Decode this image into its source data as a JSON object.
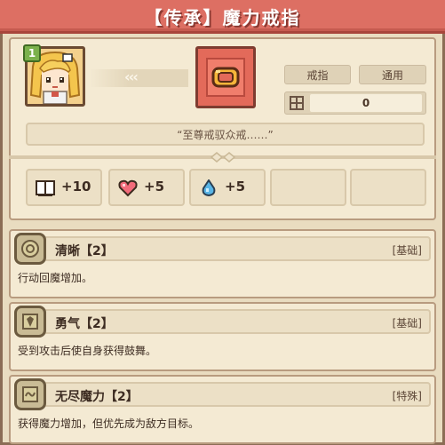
{
  "title": "【传承】魔力戒指",
  "character": {
    "level": "1"
  },
  "item": {
    "tags": [
      "戒指",
      "通用"
    ],
    "quantity": "0",
    "quote": "“至尊戒驭众戒……”"
  },
  "stats": [
    {
      "icon": "book-icon",
      "value": "+10"
    },
    {
      "icon": "heart-icon",
      "value": "+5"
    },
    {
      "icon": "water-drop-icon",
      "value": "+5"
    }
  ],
  "effects": [
    {
      "icon": "clarity-rune-icon",
      "name": "清晰【2】",
      "type": "[基础]",
      "desc": "行动回魔增加。"
    },
    {
      "icon": "courage-rune-icon",
      "name": "勇气【2】",
      "type": "[基础]",
      "desc": "受到攻击后使自身获得鼓舞。"
    },
    {
      "icon": "infinite-mana-rune-icon",
      "name": "无尽魔力【2】",
      "type": "[特殊]",
      "desc": "获得魔力增加，但优先成为敌方目标。"
    }
  ],
  "colors": {
    "title_bar": "#dd6f63",
    "panel": "#f4ead3",
    "border": "#b89b7f",
    "item_frame": "#e36a5a"
  }
}
